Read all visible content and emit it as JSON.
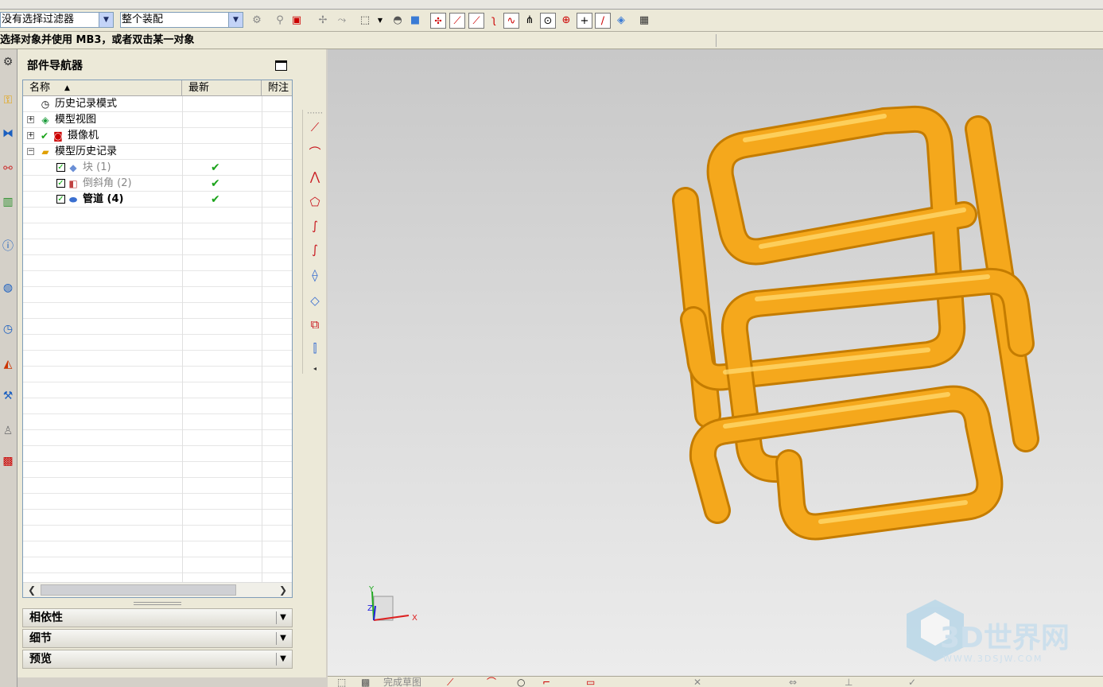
{
  "toolbar": {
    "filter_value": "没有选择过滤器",
    "assembly_value": "整个装配"
  },
  "status": {
    "prompt": "选择对象并使用 MB3，或者双击某一对象"
  },
  "navigator": {
    "title": "部件导航器",
    "columns": {
      "name": "名称",
      "latest": "最新",
      "note": "附注"
    },
    "rows": [
      {
        "label": "历史记录模式"
      },
      {
        "label": "模型视图"
      },
      {
        "label": "摄像机"
      },
      {
        "label": "模型历史记录"
      },
      {
        "label": "块 (1)"
      },
      {
        "label": "倒斜角 (2)"
      },
      {
        "label": "管道 (4)"
      }
    ],
    "panels": {
      "dependency": "相依性",
      "detail": "细节",
      "preview": "预览"
    }
  },
  "viewport": {
    "model_color": "#f5a81c",
    "triad": {
      "x": "X",
      "y": "Y",
      "z": "Z"
    },
    "watermark": {
      "brand": "3D世界网",
      "url": "WWW.3DSJW.COM"
    }
  },
  "bottom": {
    "finish_sketch": "完成草图"
  }
}
